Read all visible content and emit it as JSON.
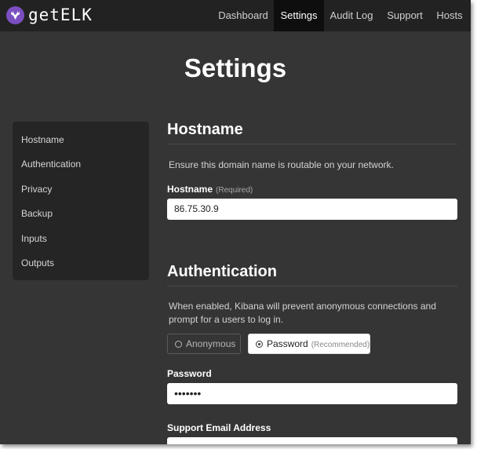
{
  "brand": {
    "name": "getELK",
    "logo_color": "#7b4fc1"
  },
  "nav": {
    "items": [
      {
        "label": "Dashboard",
        "active": false
      },
      {
        "label": "Settings",
        "active": true
      },
      {
        "label": "Audit Log",
        "active": false
      },
      {
        "label": "Support",
        "active": false
      },
      {
        "label": "Hosts",
        "active": false
      }
    ]
  },
  "page": {
    "title": "Settings"
  },
  "sidebar": {
    "items": [
      {
        "label": "Hostname"
      },
      {
        "label": "Authentication"
      },
      {
        "label": "Privacy"
      },
      {
        "label": "Backup"
      },
      {
        "label": "Inputs"
      },
      {
        "label": "Outputs"
      }
    ]
  },
  "hostname_section": {
    "heading": "Hostname",
    "help": "Ensure this domain name is routable on your network.",
    "field_label": "Hostname",
    "field_hint": "(Required)",
    "value": "86.75.30.9"
  },
  "auth_section": {
    "heading": "Authentication",
    "help": "When enabled, Kibana will prevent anonymous connections and prompt for a users to log in.",
    "options": [
      {
        "label": "Anonymous",
        "hint": "",
        "selected": false
      },
      {
        "label": "Password",
        "hint": "(Recommended)",
        "selected": true
      }
    ],
    "password_label": "Password",
    "password_value": "•••••••",
    "email_label": "Support Email Address"
  },
  "colors": {
    "background": "#353535",
    "topbar": "#222222",
    "active_nav": "#0e0e0e"
  }
}
